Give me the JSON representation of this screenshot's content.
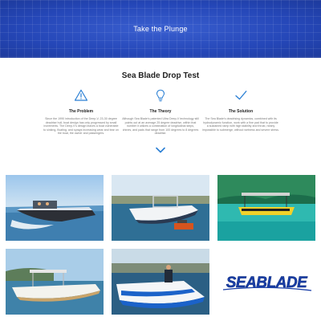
{
  "hero": {
    "title": "Take the Plunge"
  },
  "section": {
    "title": "Sea Blade Drop Test"
  },
  "features": [
    {
      "icon": "warning-icon",
      "title": "The Problem",
      "text": "Since the 1990 introduction of the Deep-V, 23-30 degree deadrise hull, boat design has only progressed by small increments. The Deep-V's design leaves a boat vulnerable to sinking, floating, and sprays increasing wear and tear on the boat, the owner and passengers."
    },
    {
      "icon": "lightbulb-icon",
      "title": "The Theory",
      "text": "Although Sea Blade's patented Ultra Deep-V technology still points out at an average 25 degree deadrise, within that number it utilizes a combination of longitudinal steps, chines, and pads that range from 100 degrees to 8 degrees deadrise."
    },
    {
      "icon": "checkmark-icon",
      "title": "The Solution",
      "text": "The Sea Blade's deadrising dynamics, combined with its hydrodynamic function, work with a fine pad that to provide a sustained ramp with high stability and thrust, nearly impossible to submerge, without wetness and severe stress."
    }
  ],
  "gallery": [
    {
      "alt": "Sea Blade boat running offshore with passengers"
    },
    {
      "alt": "White Sea Blade center console at speed"
    },
    {
      "alt": "Yellow and black Sea Blade tour boat with canopy"
    },
    {
      "alt": "Sea Blade boat with T-top cruising"
    },
    {
      "alt": "Blue and white Sea Blade boat with driver"
    }
  ],
  "logo": {
    "text": "SEABLADE"
  },
  "colors": {
    "hero_bg": "#2547b8",
    "accent": "#2a7fd4",
    "logo_blue": "#1a3fa8"
  }
}
